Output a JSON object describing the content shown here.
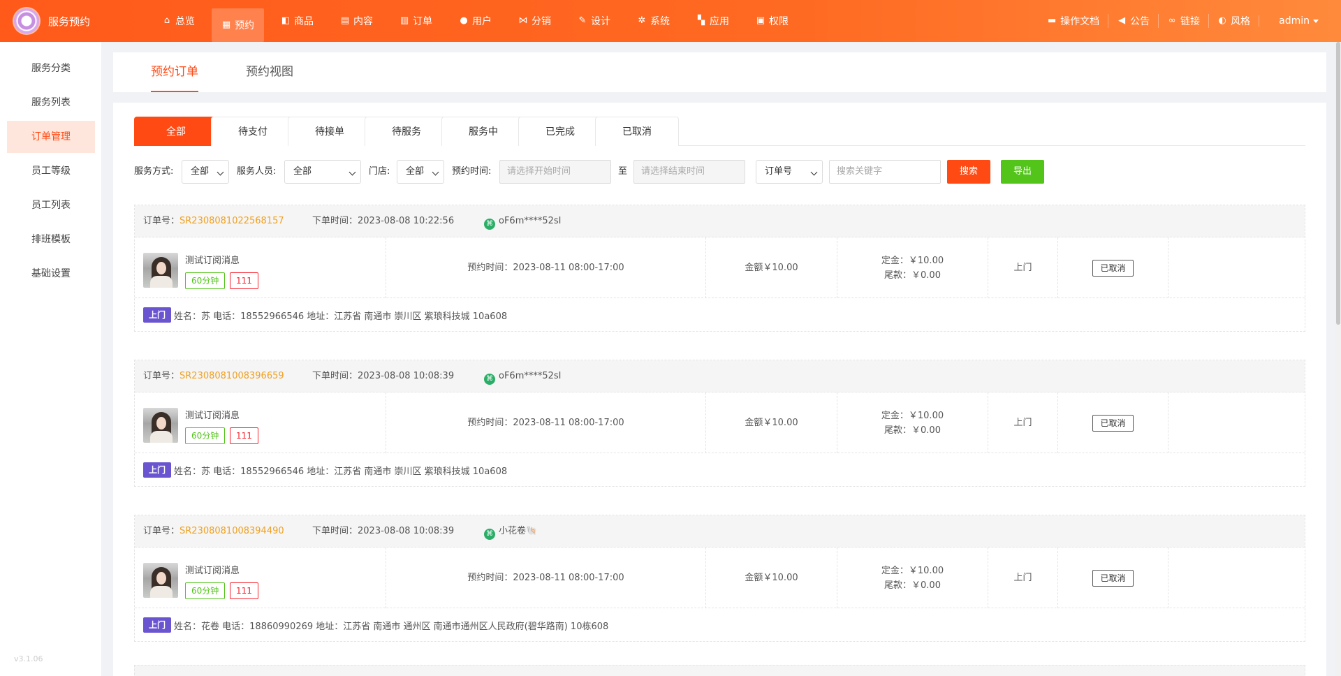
{
  "brand": {
    "title": "服务预约"
  },
  "topnav": [
    {
      "label": "总览",
      "icon": "home-icon",
      "glyph": "⌂"
    },
    {
      "label": "预约",
      "icon": "calendar-icon",
      "glyph": "▦"
    },
    {
      "label": "商品",
      "icon": "bag-icon",
      "glyph": "◧"
    },
    {
      "label": "内容",
      "icon": "document-icon",
      "glyph": "▤"
    },
    {
      "label": "订单",
      "icon": "clipboard-icon",
      "glyph": "▥"
    },
    {
      "label": "用户",
      "icon": "user-icon",
      "glyph": "●"
    },
    {
      "label": "分销",
      "icon": "share-icon",
      "glyph": "⋈"
    },
    {
      "label": "设计",
      "icon": "brush-icon",
      "glyph": "✎"
    },
    {
      "label": "系统",
      "icon": "gear-icon",
      "glyph": "✲"
    },
    {
      "label": "应用",
      "icon": "apps-icon",
      "glyph": "▚"
    },
    {
      "label": "权限",
      "icon": "lock-icon",
      "glyph": "▣"
    }
  ],
  "topright": {
    "docs": "操作文档",
    "notice": "公告",
    "link": "链接",
    "style": "风格",
    "user": "admin"
  },
  "sidebar": {
    "items": [
      "服务分类",
      "服务列表",
      "订单管理",
      "员工等级",
      "员工列表",
      "排班模板",
      "基础设置"
    ],
    "active_index": 2,
    "version": "v3.1.06"
  },
  "page_tabs": [
    "预约订单",
    "预约视图"
  ],
  "status_tabs": [
    "全部",
    "待支付",
    "待接单",
    "待服务",
    "服务中",
    "已完成",
    "已取消"
  ],
  "filters": {
    "service_mode_label": "服务方式:",
    "service_mode_value": "全部",
    "staff_label": "服务人员:",
    "staff_value": "全部",
    "store_label": "门店:",
    "store_value": "全部",
    "time_label": "预约时间:",
    "start_placeholder": "请选择开始时间",
    "to": "至",
    "end_placeholder": "请选择结束时间",
    "search_type": "订单号",
    "keyword_placeholder": "搜索关键字",
    "search_btn": "搜索",
    "export_btn": "导出"
  },
  "orders": [
    {
      "no_label": "订单号：",
      "no": "SR2308081022568157",
      "time_label": "下单时间：",
      "time": "2023-08-08 10:22:56",
      "user": "oF6m****52sI",
      "service": "测试订阅消息",
      "duration": "60分钟",
      "tag": "111",
      "appointment": "预约时间：2023-08-11 08:00-17:00",
      "amount": "金额￥10.00",
      "deposit": "定金：￥10.00",
      "balance": "尾款：￥0.00",
      "mode": "上门",
      "status": "已取消",
      "addr_badge": "上门",
      "address": "姓名：苏 电话：18552966546 地址：江苏省 南通市 崇川区 紫琅科技城 10a608"
    },
    {
      "no_label": "订单号：",
      "no": "SR2308081008396659",
      "time_label": "下单时间：",
      "time": "2023-08-08 10:08:39",
      "user": "oF6m****52sI",
      "service": "测试订阅消息",
      "duration": "60分钟",
      "tag": "111",
      "appointment": "预约时间：2023-08-11 08:00-17:00",
      "amount": "金额￥10.00",
      "deposit": "定金：￥10.00",
      "balance": "尾款：￥0.00",
      "mode": "上门",
      "status": "已取消",
      "addr_badge": "上门",
      "address": "姓名：苏 电话：18552966546 地址：江苏省 南通市 崇川区 紫琅科技城 10a608"
    },
    {
      "no_label": "订单号：",
      "no": "SR2308081008394490",
      "time_label": "下单时间：",
      "time": "2023-08-08 10:08:39",
      "user": "小花卷🐚",
      "service": "测试订阅消息",
      "duration": "60分钟",
      "tag": "111",
      "appointment": "预约时间：2023-08-11 08:00-17:00",
      "amount": "金额￥10.00",
      "deposit": "定金：￥10.00",
      "balance": "尾款：￥0.00",
      "mode": "上门",
      "status": "已取消",
      "addr_badge": "上门",
      "address": "姓名：花卷 电话：18860990269 地址：江苏省 南通市 通州区 南通市通州区人民政府(碧华路南) 10栋608"
    }
  ],
  "colors": {
    "accent": "#ff4a14",
    "export": "#52c41a",
    "order_no": "#f0a020",
    "badge": "#6a54d0"
  }
}
